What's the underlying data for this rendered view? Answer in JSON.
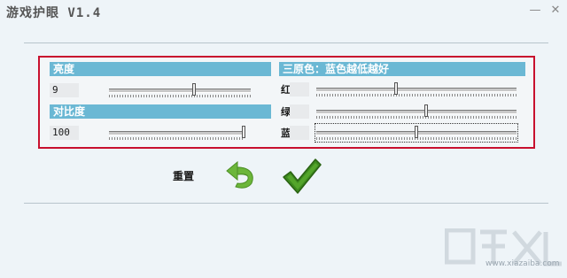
{
  "window": {
    "title": "游戏护眼 V1.4",
    "minimize_glyph": "—",
    "close_glyph": "✕"
  },
  "brightness": {
    "header": "亮度",
    "value": "9",
    "slider_fraction": 0.6
  },
  "contrast": {
    "header": "对比度",
    "value": "100",
    "slider_fraction": 1.0
  },
  "rgb": {
    "header": "三原色：蓝色越低越好",
    "red": {
      "label": "红",
      "slider_fraction": 0.4
    },
    "green": {
      "label": "绿",
      "slider_fraction": 0.55
    },
    "blue": {
      "label": "蓝",
      "slider_fraction": 0.5
    }
  },
  "actions": {
    "reset_label": "重置",
    "reset_icon": "undo-arrow-icon",
    "ok_icon": "checkmark-icon"
  },
  "colors": {
    "header_bg": "#6bb8d4",
    "group_border": "#c8102e",
    "reset_green": "#6cb63a",
    "ok_green": "#3d8a1f"
  },
  "watermark": {
    "text": "www.xiazaiba.com"
  }
}
